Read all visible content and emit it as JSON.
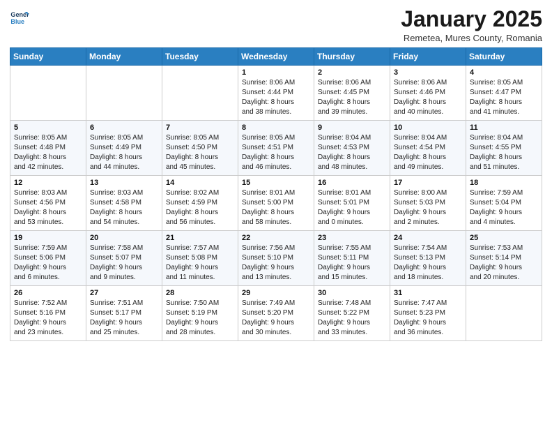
{
  "logo": {
    "line1": "General",
    "line2": "Blue"
  },
  "header": {
    "title": "January 2025",
    "subtitle": "Remetea, Mures County, Romania"
  },
  "weekdays": [
    "Sunday",
    "Monday",
    "Tuesday",
    "Wednesday",
    "Thursday",
    "Friday",
    "Saturday"
  ],
  "weeks": [
    [
      {
        "day": "",
        "info": ""
      },
      {
        "day": "",
        "info": ""
      },
      {
        "day": "",
        "info": ""
      },
      {
        "day": "1",
        "info": "Sunrise: 8:06 AM\nSunset: 4:44 PM\nDaylight: 8 hours\nand 38 minutes."
      },
      {
        "day": "2",
        "info": "Sunrise: 8:06 AM\nSunset: 4:45 PM\nDaylight: 8 hours\nand 39 minutes."
      },
      {
        "day": "3",
        "info": "Sunrise: 8:06 AM\nSunset: 4:46 PM\nDaylight: 8 hours\nand 40 minutes."
      },
      {
        "day": "4",
        "info": "Sunrise: 8:05 AM\nSunset: 4:47 PM\nDaylight: 8 hours\nand 41 minutes."
      }
    ],
    [
      {
        "day": "5",
        "info": "Sunrise: 8:05 AM\nSunset: 4:48 PM\nDaylight: 8 hours\nand 42 minutes."
      },
      {
        "day": "6",
        "info": "Sunrise: 8:05 AM\nSunset: 4:49 PM\nDaylight: 8 hours\nand 44 minutes."
      },
      {
        "day": "7",
        "info": "Sunrise: 8:05 AM\nSunset: 4:50 PM\nDaylight: 8 hours\nand 45 minutes."
      },
      {
        "day": "8",
        "info": "Sunrise: 8:05 AM\nSunset: 4:51 PM\nDaylight: 8 hours\nand 46 minutes."
      },
      {
        "day": "9",
        "info": "Sunrise: 8:04 AM\nSunset: 4:53 PM\nDaylight: 8 hours\nand 48 minutes."
      },
      {
        "day": "10",
        "info": "Sunrise: 8:04 AM\nSunset: 4:54 PM\nDaylight: 8 hours\nand 49 minutes."
      },
      {
        "day": "11",
        "info": "Sunrise: 8:04 AM\nSunset: 4:55 PM\nDaylight: 8 hours\nand 51 minutes."
      }
    ],
    [
      {
        "day": "12",
        "info": "Sunrise: 8:03 AM\nSunset: 4:56 PM\nDaylight: 8 hours\nand 53 minutes."
      },
      {
        "day": "13",
        "info": "Sunrise: 8:03 AM\nSunset: 4:58 PM\nDaylight: 8 hours\nand 54 minutes."
      },
      {
        "day": "14",
        "info": "Sunrise: 8:02 AM\nSunset: 4:59 PM\nDaylight: 8 hours\nand 56 minutes."
      },
      {
        "day": "15",
        "info": "Sunrise: 8:01 AM\nSunset: 5:00 PM\nDaylight: 8 hours\nand 58 minutes."
      },
      {
        "day": "16",
        "info": "Sunrise: 8:01 AM\nSunset: 5:01 PM\nDaylight: 9 hours\nand 0 minutes."
      },
      {
        "day": "17",
        "info": "Sunrise: 8:00 AM\nSunset: 5:03 PM\nDaylight: 9 hours\nand 2 minutes."
      },
      {
        "day": "18",
        "info": "Sunrise: 7:59 AM\nSunset: 5:04 PM\nDaylight: 9 hours\nand 4 minutes."
      }
    ],
    [
      {
        "day": "19",
        "info": "Sunrise: 7:59 AM\nSunset: 5:06 PM\nDaylight: 9 hours\nand 6 minutes."
      },
      {
        "day": "20",
        "info": "Sunrise: 7:58 AM\nSunset: 5:07 PM\nDaylight: 9 hours\nand 9 minutes."
      },
      {
        "day": "21",
        "info": "Sunrise: 7:57 AM\nSunset: 5:08 PM\nDaylight: 9 hours\nand 11 minutes."
      },
      {
        "day": "22",
        "info": "Sunrise: 7:56 AM\nSunset: 5:10 PM\nDaylight: 9 hours\nand 13 minutes."
      },
      {
        "day": "23",
        "info": "Sunrise: 7:55 AM\nSunset: 5:11 PM\nDaylight: 9 hours\nand 15 minutes."
      },
      {
        "day": "24",
        "info": "Sunrise: 7:54 AM\nSunset: 5:13 PM\nDaylight: 9 hours\nand 18 minutes."
      },
      {
        "day": "25",
        "info": "Sunrise: 7:53 AM\nSunset: 5:14 PM\nDaylight: 9 hours\nand 20 minutes."
      }
    ],
    [
      {
        "day": "26",
        "info": "Sunrise: 7:52 AM\nSunset: 5:16 PM\nDaylight: 9 hours\nand 23 minutes."
      },
      {
        "day": "27",
        "info": "Sunrise: 7:51 AM\nSunset: 5:17 PM\nDaylight: 9 hours\nand 25 minutes."
      },
      {
        "day": "28",
        "info": "Sunrise: 7:50 AM\nSunset: 5:19 PM\nDaylight: 9 hours\nand 28 minutes."
      },
      {
        "day": "29",
        "info": "Sunrise: 7:49 AM\nSunset: 5:20 PM\nDaylight: 9 hours\nand 30 minutes."
      },
      {
        "day": "30",
        "info": "Sunrise: 7:48 AM\nSunset: 5:22 PM\nDaylight: 9 hours\nand 33 minutes."
      },
      {
        "day": "31",
        "info": "Sunrise: 7:47 AM\nSunset: 5:23 PM\nDaylight: 9 hours\nand 36 minutes."
      },
      {
        "day": "",
        "info": ""
      }
    ]
  ]
}
